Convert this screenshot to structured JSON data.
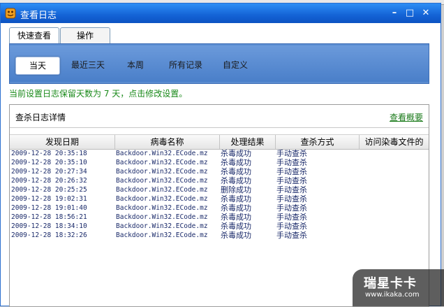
{
  "window": {
    "title": "查看日志",
    "minimize": "–",
    "maximize": "□",
    "close": "✕"
  },
  "tabs": [
    {
      "label": "快速查看"
    },
    {
      "label": "操作"
    }
  ],
  "filters": [
    {
      "label": "当天"
    },
    {
      "label": "最近三天"
    },
    {
      "label": "本周"
    },
    {
      "label": "所有记录"
    },
    {
      "label": "自定义"
    }
  ],
  "notice": "当前设置日志保留天数为 7 天，点击修改设置。",
  "log": {
    "title": "查杀日志详情",
    "summary_link": "查看概要",
    "columns": [
      "发现日期",
      "病毒名称",
      "处理结果",
      "查杀方式",
      "访问染毒文件的"
    ],
    "rows": [
      [
        "2009-12-28 20:35:18",
        "Backdoor.Win32.ECode.mz",
        "杀毒成功",
        "手动查杀"
      ],
      [
        "2009-12-28 20:35:10",
        "Backdoor.Win32.ECode.mz",
        "杀毒成功",
        "手动查杀"
      ],
      [
        "2009-12-28 20:27:34",
        "Backdoor.Win32.ECode.mz",
        "杀毒成功",
        "手动查杀"
      ],
      [
        "2009-12-28 20:26:32",
        "Backdoor.Win32.ECode.mz",
        "杀毒成功",
        "手动查杀"
      ],
      [
        "2009-12-28 20:25:25",
        "Backdoor.Win32.ECode.mz",
        "删除成功",
        "手动查杀"
      ],
      [
        "2009-12-28 19:02:31",
        "Backdoor.Win32.ECode.mz",
        "杀毒成功",
        "手动查杀"
      ],
      [
        "2009-12-28 19:01:40",
        "Backdoor.Win32.ECode.mz",
        "杀毒成功",
        "手动查杀"
      ],
      [
        "2009-12-28 18:56:21",
        "Backdoor.Win32.ECode.mz",
        "杀毒成功",
        "手动查杀"
      ],
      [
        "2009-12-28 18:34:10",
        "Backdoor.Win32.ECode.mz",
        "杀毒成功",
        "手动查杀"
      ],
      [
        "2009-12-28 18:32:26",
        "Backdoor.Win32.ECode.mz",
        "杀毒成功",
        "手动查杀"
      ]
    ]
  },
  "watermark": {
    "logo": "瑞星卡卡",
    "url": "www.ikaka.com"
  },
  "colors": {
    "titlebar": "#1463d6",
    "panel": "#5b8dd1",
    "notice": "#1a8a1a"
  }
}
